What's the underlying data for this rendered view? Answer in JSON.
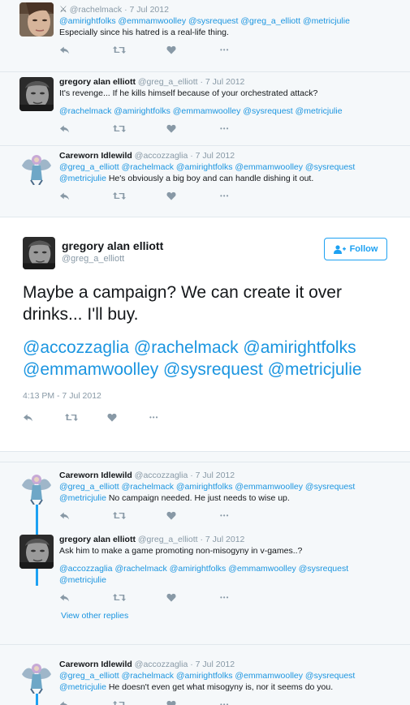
{
  "top_tweets": [
    {
      "name": "",
      "handle": "@rachelmack",
      "date": "7 Jul 2012",
      "lines": [
        [
          "@amirightfolks @emmamwoolley @sysrequest @greg_a_elliott @metricjulie"
        ],
        "Especially since his hatred is a real-life thing."
      ],
      "avatar": "woman-face"
    },
    {
      "name": "gregory alan elliott",
      "handle": "@greg_a_elliott",
      "date": "7 Jul 2012",
      "text": "It's revenge... If he kills himself because of your orchestrated attack?",
      "mentions": "@rachelmack @amirightfolks @emmamwoolley @sysrequest @metricjulie",
      "avatar": "man-face"
    },
    {
      "name": "Careworn Idlewild",
      "handle": "@accozzaglia",
      "date": "7 Jul 2012",
      "mentions_line1": "@greg_a_elliott @rachelmack @amirightfolks @emmamwoolley @sysrequest",
      "mentions_line2_mention": "@metricjulie",
      "mentions_line2_text": " He's obviously a big boy and can handle dishing it out.",
      "avatar": "cartoon-figure"
    }
  ],
  "main_tweet": {
    "name": "gregory alan elliott",
    "handle": "@greg_a_elliott",
    "follow_label": "Follow",
    "text": "Maybe a campaign? We can create it over drinks... I'll buy.",
    "mentions": "@accozzaglia @rachelmack @amirightfolks @emmamwoolley @sysrequest @metricjulie",
    "timestamp": "4:13 PM - 7 Jul 2012"
  },
  "replies": [
    {
      "name": "Careworn Idlewild",
      "handle": "@accozzaglia",
      "date": "7 Jul 2012",
      "mentions_line1": "@greg_a_elliott @rachelmack @amirightfolks @emmamwoolley @sysrequest",
      "mentions_line2_mention": "@metricjulie",
      "mentions_line2_text": " No campaign needed. He just needs to wise up."
    },
    {
      "name": "gregory alan elliott",
      "handle": "@greg_a_elliott",
      "date": "7 Jul 2012",
      "text": "Ask him to make a game promoting non-misogyny in v-games..?",
      "mentions_line1": "@accozzaglia @rachelmack @amirightfolks @emmamwoolley @sysrequest",
      "mentions_line2": "@metricjulie",
      "view_other": "View other replies"
    },
    {
      "name": "Careworn Idlewild",
      "handle": "@accozzaglia",
      "date": "7 Jul 2012",
      "mentions_line1": "@greg_a_elliott @rachelmack @amirightfolks @emmamwoolley @sysrequest",
      "mentions_line2_mention": "@metricjulie",
      "mentions_line2_text": " He doesn't even get what misogyny is, nor it seems do you."
    }
  ],
  "separator": "·",
  "more_glyph": "•••",
  "colors": {
    "link": "#1b95e0",
    "muted": "#8899a6",
    "accent": "#1da1f2",
    "bg": "#f5f8fa"
  }
}
